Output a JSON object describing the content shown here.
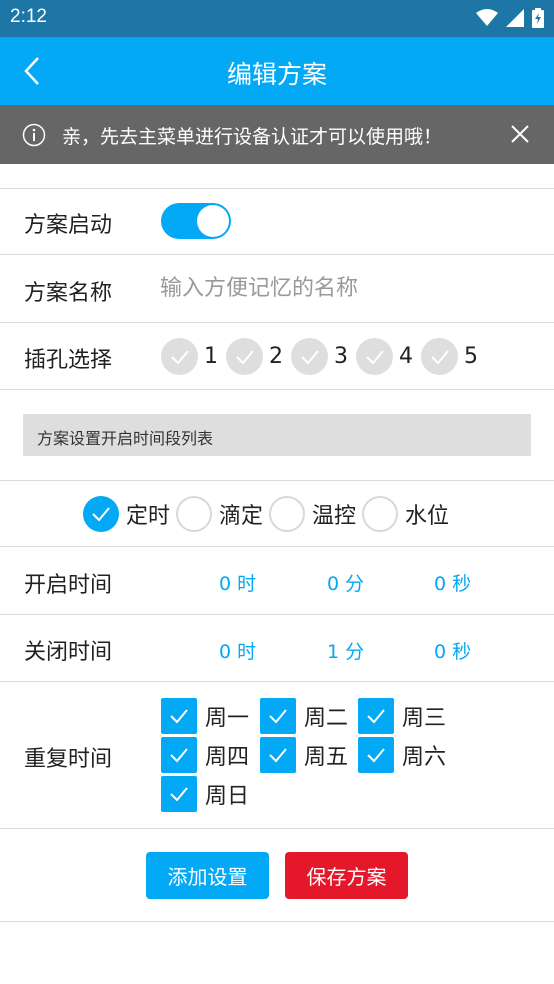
{
  "status_bar": {
    "time": "2:12"
  },
  "app_bar": {
    "title": "编辑方案"
  },
  "notice": {
    "text": "亲，先去主菜单进行设备认证才可以使用哦！"
  },
  "scheme_enable": {
    "label": "方案启动",
    "enabled": true
  },
  "scheme_name": {
    "label": "方案名称",
    "placeholder": "输入方便记忆的名称",
    "value": ""
  },
  "socket_select": {
    "label": "插孔选择",
    "sockets": [
      {
        "number": "1",
        "checked": false
      },
      {
        "number": "2",
        "checked": false
      },
      {
        "number": "3",
        "checked": false
      },
      {
        "number": "4",
        "checked": false
      },
      {
        "number": "5",
        "checked": false
      }
    ]
  },
  "section_header": "方案设置开启时间段列表",
  "modes": [
    {
      "label": "定时",
      "selected": true
    },
    {
      "label": "滴定",
      "selected": false
    },
    {
      "label": "温控",
      "selected": false
    },
    {
      "label": "水位",
      "selected": false
    }
  ],
  "open_time": {
    "label": "开启时间",
    "hour": "0 时",
    "minute": "0 分",
    "second": "0 秒"
  },
  "close_time": {
    "label": "关闭时间",
    "hour": "0 时",
    "minute": "1 分",
    "second": "0 秒"
  },
  "repeat": {
    "label": "重复时间",
    "days": [
      {
        "label": "周一",
        "checked": true
      },
      {
        "label": "周二",
        "checked": true
      },
      {
        "label": "周三",
        "checked": true
      },
      {
        "label": "周四",
        "checked": true
      },
      {
        "label": "周五",
        "checked": true
      },
      {
        "label": "周六",
        "checked": true
      },
      {
        "label": "周日",
        "checked": true
      }
    ]
  },
  "buttons": {
    "add": "添加设置",
    "save": "保存方案"
  },
  "colors": {
    "primary": "#03a9f4",
    "status_bar": "#1e76a6",
    "notice_bg": "#666666",
    "danger": "#e4182a",
    "inactive": "#dedede"
  }
}
